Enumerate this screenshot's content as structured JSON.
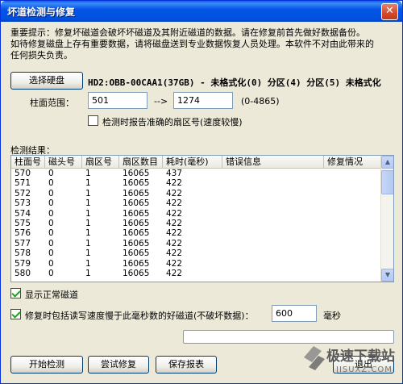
{
  "window": {
    "title": "坏道检测与修复",
    "close_symbol": "✕"
  },
  "notice": {
    "line1": "重要提示：修复坏磁道会破坏坏磁道及其附近磁道的数据。请在修复前首先做好数据备份。",
    "line2": "如待修复磁盘上存有重要数据，请将磁盘送到专业数据恢复人员处理。本软件不对由此带来的",
    "line3": "任何损失负责。"
  },
  "disk": {
    "select_button": "选择硬盘",
    "info": "HD2:OBB-00CAA1(37GB) - 未格式化(0) 分区(4) 分区(5) 未格式化"
  },
  "range": {
    "label": "柱面范围：",
    "from": "501",
    "arrow": "-->",
    "to": "1274",
    "hint": "(0-4865)"
  },
  "options": {
    "report_sector_label": "检测时报告准确的扇区号(速度较慢)",
    "report_sector_checked": false,
    "show_normal_label": "显示正常磁道",
    "show_normal_checked": true,
    "include_slow_label": "修复时包括读写速度慢于此毫秒数的好磁道(不破坏数据)：",
    "include_slow_checked": true,
    "slow_ms_value": "600",
    "slow_ms_unit": "毫秒"
  },
  "results": {
    "label": "检测结果：",
    "columns": [
      "柱面号",
      "磁头号",
      "扇区号",
      "扇区数目",
      "耗时(毫秒)",
      "错误信息",
      "修复情况"
    ],
    "rows": [
      [
        "570",
        "0",
        "1",
        "16065",
        "437",
        "",
        ""
      ],
      [
        "571",
        "0",
        "1",
        "16065",
        "422",
        "",
        ""
      ],
      [
        "572",
        "0",
        "1",
        "16065",
        "422",
        "",
        ""
      ],
      [
        "573",
        "0",
        "1",
        "16065",
        "422",
        "",
        ""
      ],
      [
        "574",
        "0",
        "1",
        "16065",
        "422",
        "",
        ""
      ],
      [
        "575",
        "0",
        "1",
        "16065",
        "422",
        "",
        ""
      ],
      [
        "576",
        "0",
        "1",
        "16065",
        "422",
        "",
        ""
      ],
      [
        "577",
        "0",
        "1",
        "16065",
        "422",
        "",
        ""
      ],
      [
        "578",
        "0",
        "1",
        "16065",
        "422",
        "",
        ""
      ],
      [
        "579",
        "0",
        "1",
        "16065",
        "422",
        "",
        ""
      ],
      [
        "580",
        "0",
        "1",
        "16065",
        "422",
        "",
        ""
      ]
    ]
  },
  "buttons": {
    "start": "开始检测",
    "try_repair": "尝试修复",
    "save_report": "保存报表",
    "exit": "退出"
  },
  "watermark": {
    "text": "极速下载站",
    "sub": "JISUXZ.COM"
  },
  "colors": {
    "titlebar": "#0054e3",
    "window_bg": "#ece9d8",
    "input_border": "#7f9db9"
  }
}
